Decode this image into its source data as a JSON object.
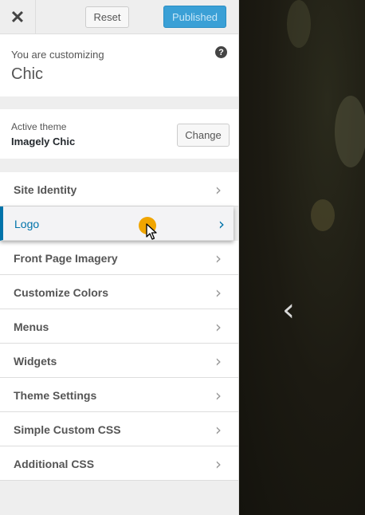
{
  "header": {
    "close_symbol": "✕",
    "reset_label": "Reset",
    "publish_label": "Published"
  },
  "info": {
    "subtitle": "You are customizing",
    "title": "Chic",
    "help_symbol": "?"
  },
  "theme": {
    "label": "Active theme",
    "name": "Imagely Chic",
    "change_label": "Change"
  },
  "menu": {
    "items": [
      {
        "label": "Site Identity"
      },
      {
        "label": "Logo"
      },
      {
        "label": "Front Page Imagery"
      },
      {
        "label": "Customize Colors"
      },
      {
        "label": "Menus"
      },
      {
        "label": "Widgets"
      },
      {
        "label": "Theme Settings"
      },
      {
        "label": "Simple Custom CSS"
      },
      {
        "label": "Additional CSS"
      }
    ],
    "chevron": "›"
  },
  "preview": {
    "prev_arrow": "‹"
  }
}
